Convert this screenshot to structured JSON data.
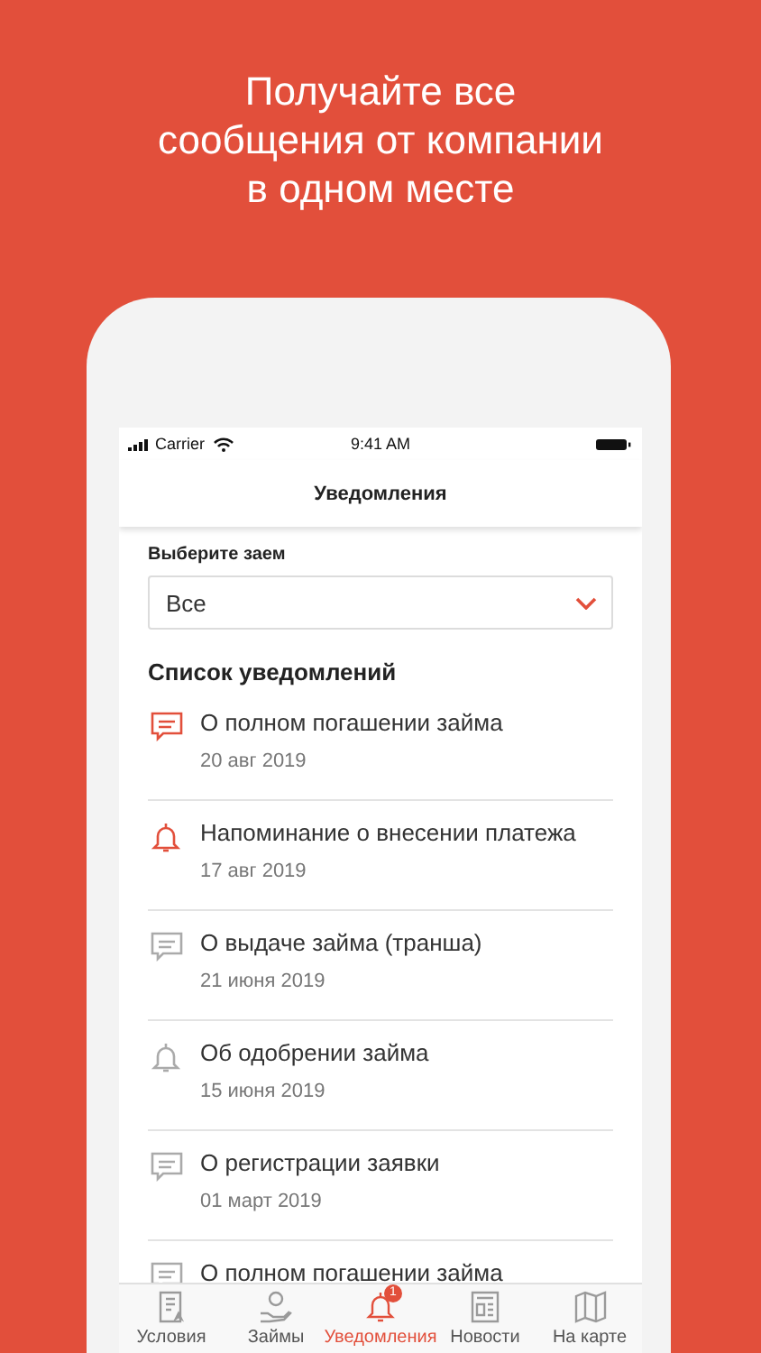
{
  "promo": {
    "headline_lines": [
      "Получайте все",
      "сообщения от компании",
      "в одном месте"
    ]
  },
  "status_bar": {
    "carrier": "Carrier",
    "time": "9:41 AM"
  },
  "header": {
    "title": "Уведомления"
  },
  "loan_filter": {
    "label": "Выберите заем",
    "value": "Все"
  },
  "section_title": "Список уведомлений",
  "notifications": [
    {
      "kind": "sms",
      "unread": true,
      "title": "О полном погашении займа",
      "date": "20 авг 2019"
    },
    {
      "kind": "bell",
      "unread": true,
      "title": "Напоминание о внесении платежа",
      "date": "17 авг 2019"
    },
    {
      "kind": "sms",
      "unread": false,
      "title": "О выдаче займа (транша)",
      "date": "21 июня 2019"
    },
    {
      "kind": "bell",
      "unread": false,
      "title": "Об одобрении займа",
      "date": "15 июня 2019"
    },
    {
      "kind": "sms",
      "unread": false,
      "title": "О регистрации заявки",
      "date": "01 март 2019"
    },
    {
      "kind": "sms",
      "unread": false,
      "title": "О полном погашении займа"
    }
  ],
  "tabs": [
    {
      "kind": "document",
      "label": "Условия",
      "selected": false
    },
    {
      "kind": "coin-hand",
      "label": "Займы",
      "selected": false
    },
    {
      "kind": "bell",
      "label": "Уведомления",
      "selected": true,
      "badge": "1"
    },
    {
      "kind": "newspaper",
      "label": "Новости",
      "selected": false
    },
    {
      "kind": "map",
      "label": "На карте",
      "selected": false
    }
  ]
}
